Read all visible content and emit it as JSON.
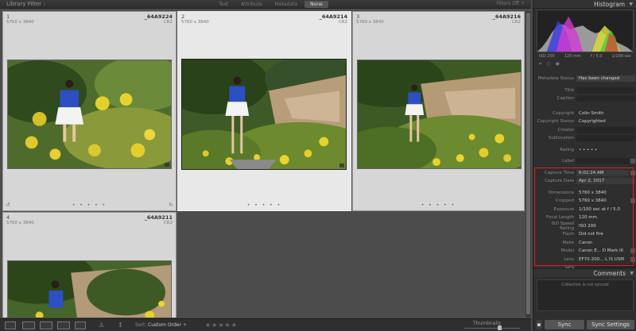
{
  "filter_bar": {
    "title": "Library Filter :",
    "tabs": [
      "Text",
      "Attribute",
      "Metadata",
      "None"
    ],
    "active_tab": "None",
    "filters_off": "Filters Off ÷"
  },
  "grid": {
    "cells": [
      {
        "index": "1",
        "dimensions": "5760 x 3840",
        "filename": "_64A9224",
        "ext": "CR2"
      },
      {
        "index": "2",
        "dimensions": "5760 x 3840",
        "filename": "_64A9214",
        "ext": "CR2"
      },
      {
        "index": "3",
        "dimensions": "5760 x 3840",
        "filename": "_64A9216",
        "ext": "CR2"
      },
      {
        "index": "4",
        "dimensions": "5760 x 3840",
        "filename": "_64A9211",
        "ext": "CR2"
      }
    ],
    "rating_dots": "• • • • •"
  },
  "histogram": {
    "header": "Histogram",
    "iso": "ISO 200",
    "focal": "120 mm",
    "aperture": "f / 5.0",
    "shutter": "1/100 sec"
  },
  "metadata": {
    "status_label": "Metadata Status",
    "status_value": "Has been changed",
    "rows_top": [
      {
        "k": "Title",
        "v": ""
      },
      {
        "k": "Caption",
        "v": ""
      }
    ],
    "rows_copyright": [
      {
        "k": "Copyright",
        "v": "Colin Smith"
      },
      {
        "k": "Copyright Status",
        "v": "Copyrighted"
      },
      {
        "k": "Creator",
        "v": ""
      },
      {
        "k": "Sublocation",
        "v": ""
      }
    ],
    "rating": {
      "k": "Rating",
      "v": "• • • • •"
    },
    "label": {
      "k": "Label",
      "v": ""
    },
    "rows_capture": [
      {
        "k": "Capture Time",
        "v": "6:02:24 AM"
      },
      {
        "k": "Capture Date",
        "v": "Apr 2, 2017"
      }
    ],
    "rows_exif": [
      {
        "k": "Dimensions",
        "v": "5760 x 3840"
      },
      {
        "k": "Cropped",
        "v": "5760 x 3840"
      },
      {
        "k": "Exposure",
        "v": "1/100 sec at f / 5.0"
      },
      {
        "k": "Focal Length",
        "v": "120 mm"
      },
      {
        "k": "ISO Speed Rating",
        "v": "ISO 200"
      },
      {
        "k": "Flash",
        "v": "Did not fire"
      },
      {
        "k": "Make",
        "v": "Canon"
      },
      {
        "k": "Model",
        "v": "Canon E... D Mark III"
      },
      {
        "k": "Lens",
        "v": "EF70-200... L IS USM"
      },
      {
        "k": "GPS",
        "v": ""
      }
    ]
  },
  "comments": {
    "header": "Comments",
    "empty_text": "Collection is not synced"
  },
  "sync": {
    "sync_label": "Sync",
    "settings_label": "Sync Settings"
  },
  "toolbar": {
    "sort_label": "Sort:",
    "sort_value": "Custom Order ÷",
    "stars": "★★★★★",
    "thumbnails_label": "Thumbnails"
  },
  "colors": {
    "highlight": "#e02020",
    "panel_bg": "#2e2e2e",
    "grid_bg": "#4c4c4c"
  }
}
